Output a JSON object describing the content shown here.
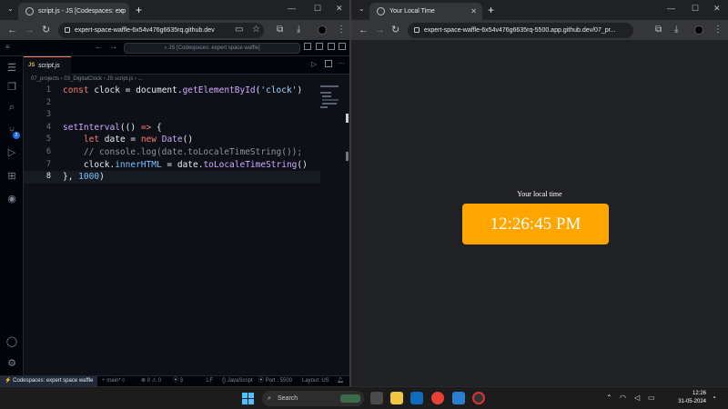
{
  "left_browser": {
    "tab_title": "script.js - JS [Codespaces: exp",
    "url": "expert-space-waffle-6x54v476g6635rq.github.dev"
  },
  "right_browser": {
    "tab_title": "Your Local Time",
    "url": "expert-space-waffle-6x54v476g6635rq-5500.app.github.dev/07_pr..."
  },
  "vscode": {
    "command_center": "JS [Codespaces: expert space waffle]",
    "editor_tab": "script.js",
    "tab_icon": "JS",
    "breadcrumb": "07_projects  ›  03_DigitalClock  ›  JS script.js  ›  ...",
    "scm_badge": "2",
    "code_lines": [
      {
        "num": "1",
        "parts": [
          [
            "k",
            "const "
          ],
          [
            "",
            "clock = "
          ],
          [
            "",
            "document."
          ],
          [
            "f",
            "getElementById"
          ],
          [
            "",
            "("
          ],
          [
            "s",
            "'clock'"
          ],
          [
            "",
            ")"
          ]
        ]
      },
      {
        "num": "2",
        "parts": []
      },
      {
        "num": "3",
        "parts": []
      },
      {
        "num": "4",
        "parts": [
          [
            "f",
            "setInterval"
          ],
          [
            "",
            "(() "
          ],
          [
            "k",
            "=>"
          ],
          [
            "",
            " {"
          ]
        ]
      },
      {
        "num": "5",
        "parts": [
          [
            "",
            "    "
          ],
          [
            "k",
            "let "
          ],
          [
            "",
            "date = "
          ],
          [
            "k",
            "new "
          ],
          [
            "f",
            "Date"
          ],
          [
            "",
            "()"
          ]
        ]
      },
      {
        "num": "6",
        "parts": [
          [
            "c",
            "    // console.log(date.toLocaleTimeString());"
          ]
        ]
      },
      {
        "num": "7",
        "parts": [
          [
            "",
            "    clock."
          ],
          [
            "n",
            "innerHTML"
          ],
          [
            "",
            " = date."
          ],
          [
            "f",
            "toLocaleTimeString"
          ],
          [
            "",
            "()"
          ]
        ]
      },
      {
        "num": "8",
        "parts": [
          [
            "",
            "}, "
          ],
          [
            "n",
            "1000"
          ],
          [
            "",
            ")"
          ]
        ]
      }
    ],
    "current_line": "8",
    "status": {
      "remote": "Codespaces: expert space waffle",
      "branch": "main*",
      "errors": "0",
      "warnings": "0",
      "ports": "3",
      "eol": "LF",
      "language": "JavaScript",
      "port": "Port : 5500",
      "layout": "Layout: US"
    }
  },
  "page": {
    "heading": "Your local time",
    "clock_text": "12:26:45 PM"
  },
  "taskbar": {
    "search_placeholder": "Search",
    "time": "12:26",
    "date": "31-05-2024"
  }
}
